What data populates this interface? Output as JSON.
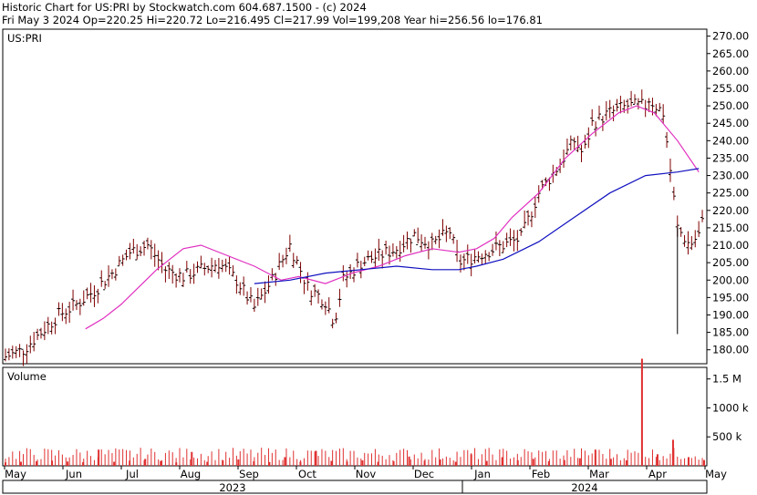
{
  "header": {
    "line1": "Historic Chart for US:PRI by Stockwatch.com 604.687.1500 - (c) 2024",
    "line2": "Fri May  3 2024   Op=220.25   Hi=220.72   Lo=216.495   Cl=217.99   Vol=199,208   Year hi=256.56   lo=176.81"
  },
  "chart_data": [
    {
      "type": "line",
      "panel": "price",
      "symbol_label": "US:PRI",
      "ylim": [
        176,
        272
      ],
      "y_ticks": [
        "270.00",
        "265.00",
        "260.00",
        "255.00",
        "250.00",
        "245.00",
        "240.00",
        "235.00",
        "230.00",
        "225.00",
        "220.00",
        "215.00",
        "210.00",
        "205.00",
        "200.00",
        "195.00",
        "190.00",
        "185.00",
        "180.00"
      ],
      "x_ticks": [
        "May",
        "Jun",
        "Jul",
        "Aug",
        "Sep",
        "Oct",
        "Nov",
        "Dec",
        "Jan",
        "Feb",
        "Mar",
        "Apr",
        "May"
      ],
      "year_labels": [
        "2023",
        "2024"
      ],
      "grid": false,
      "colors": {
        "bars": "#800000",
        "ma_short": "#e030c0",
        "ma_long": "#1010c0",
        "frame": "#000000"
      },
      "series": [
        {
          "values_kind": "close",
          "x": [
            0,
            10,
            20,
            30,
            40,
            50,
            60,
            70,
            80,
            90,
            100,
            110,
            120,
            130,
            140,
            150,
            160,
            170,
            180,
            185,
            190,
            200,
            210,
            220,
            230,
            240,
            250,
            255,
            260,
            270,
            280,
            290,
            300,
            310,
            320,
            325,
            330,
            340,
            350,
            360,
            362,
            370,
            378,
            385,
            390,
            393
          ],
          "values": [
            178,
            180,
            185,
            190,
            193,
            197,
            202,
            208,
            210,
            203,
            201,
            203,
            205,
            200,
            192,
            200,
            210,
            198,
            194,
            188,
            200,
            205,
            207,
            209,
            213,
            210,
            214,
            205,
            206,
            208,
            210,
            212,
            225,
            232,
            240,
            236,
            245,
            248,
            250,
            250,
            252,
            248,
            215,
            210,
            213,
            218
          ]
        },
        {
          "values_kind": "ma_short",
          "x": [
            45,
            55,
            65,
            75,
            85,
            100,
            110,
            125,
            140,
            155,
            165,
            180,
            195,
            210,
            225,
            240,
            255,
            265,
            275,
            285,
            300,
            315,
            330,
            345,
            355,
            365,
            378,
            390
          ],
          "values": [
            186,
            189,
            193,
            198,
            203,
            209,
            210,
            207,
            204,
            200,
            201,
            199,
            202,
            204,
            207,
            209,
            208,
            209,
            212,
            218,
            225,
            235,
            242,
            248,
            250,
            248,
            240,
            231
          ]
        },
        {
          "values_kind": "ma_long",
          "x": [
            140,
            160,
            180,
            200,
            220,
            240,
            255,
            265,
            280,
            300,
            320,
            340,
            360,
            378,
            390
          ],
          "values": [
            199,
            200,
            202,
            203,
            204,
            203,
            203,
            204,
            206,
            211,
            218,
            225,
            230,
            231,
            232
          ]
        }
      ]
    },
    {
      "type": "bar",
      "panel": "volume",
      "title": "Volume",
      "ylim": [
        0,
        1700000
      ],
      "y_ticks": [
        "1.5 M",
        "1000 k",
        "500 k"
      ],
      "colors": {
        "bars": "#e03030"
      },
      "values": [
        60000,
        70000,
        80000,
        90000,
        75000,
        65000,
        280000,
        70000,
        90000,
        120000,
        85000,
        60000,
        240000,
        70000,
        95000,
        110000,
        80000,
        65000,
        150000,
        70000,
        260000,
        85000,
        75000,
        95000,
        70000,
        80000,
        160000,
        90000,
        110000,
        70000,
        200000,
        85000,
        150000,
        95000,
        120000,
        80000,
        100000,
        130000,
        280000,
        120000,
        95000,
        1850000,
        200000,
        450000,
        150000,
        100000
      ]
    }
  ]
}
